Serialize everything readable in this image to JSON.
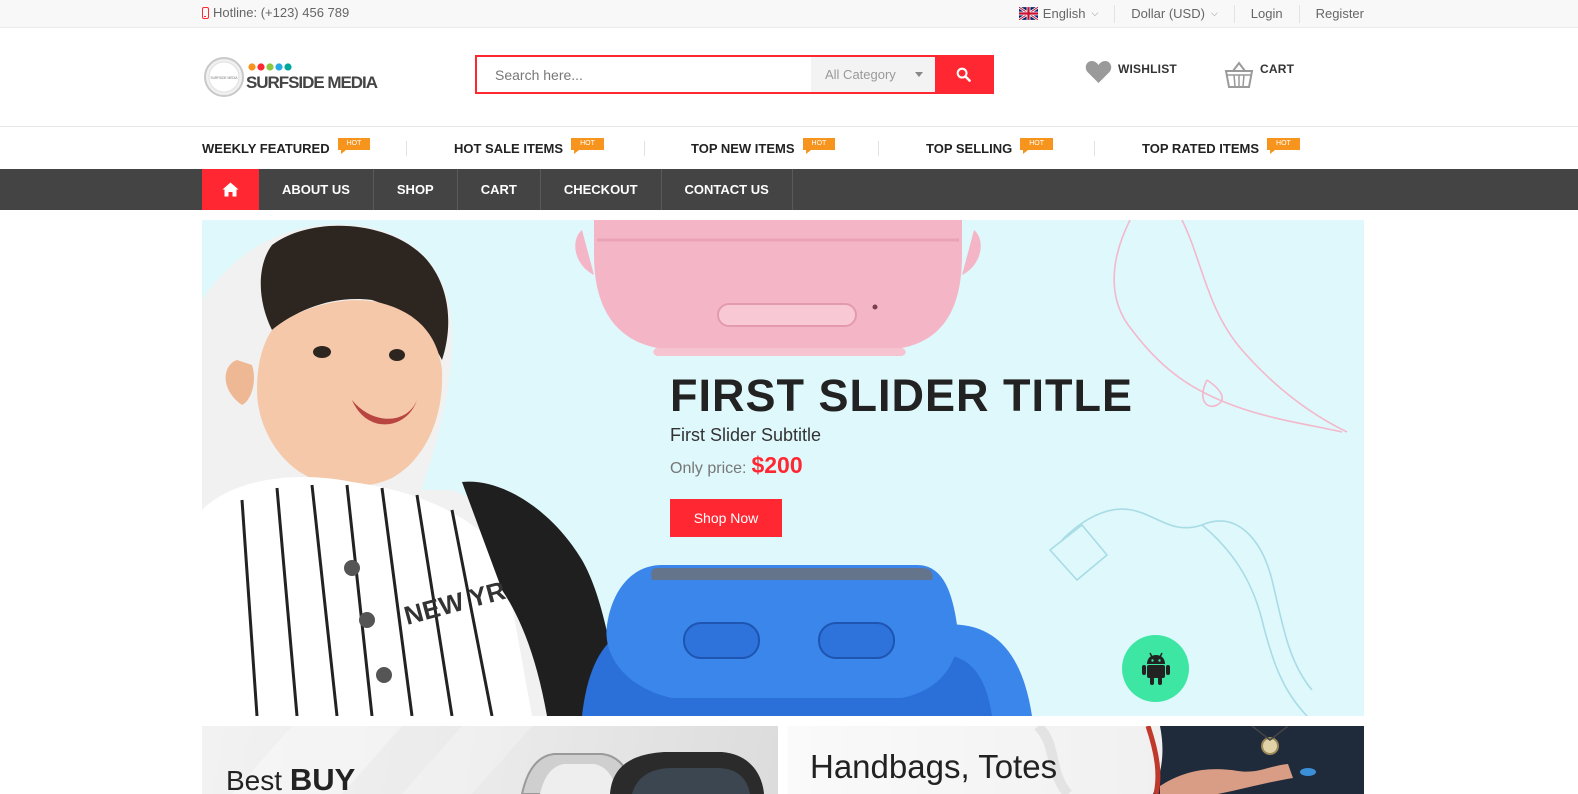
{
  "topbar": {
    "hotline": "Hotline: (+123) 456 789",
    "language": "English",
    "currency": "Dollar (USD)",
    "login": "Login",
    "register": "Register"
  },
  "logo": {
    "text": "SURFSIDE MEDIA",
    "small_text": "SURFSIDE MEDIA"
  },
  "search": {
    "placeholder": "Search here...",
    "category": "All Category"
  },
  "header": {
    "wishlist": "WISHLIST",
    "cart": "CART"
  },
  "featured": {
    "hot_badge": "HOT",
    "items": [
      "WEEKLY FEATURED",
      "HOT SALE ITEMS",
      "TOP NEW ITEMS",
      "TOP SELLING",
      "TOP RATED ITEMS"
    ]
  },
  "nav": {
    "items": [
      "ABOUT US",
      "SHOP",
      "CART",
      "CHECKOUT",
      "CONTACT US"
    ]
  },
  "slider": {
    "title": "FIRST SLIDER TITLE",
    "subtitle": "First Slider Subtitle",
    "price_label": "Only price:",
    "price": "$200",
    "button": "Shop Now",
    "watch_text": "NEW YR"
  },
  "banners": {
    "left_prefix": "Best ",
    "left_bold": "BUY",
    "right": "Handbags, Totes"
  },
  "colors": {
    "accent": "#ff2832",
    "nav_bg": "#444444",
    "hot_badge": "#f7941d",
    "slider_bg": "#dff8fb",
    "android": "#3ee6a4"
  }
}
